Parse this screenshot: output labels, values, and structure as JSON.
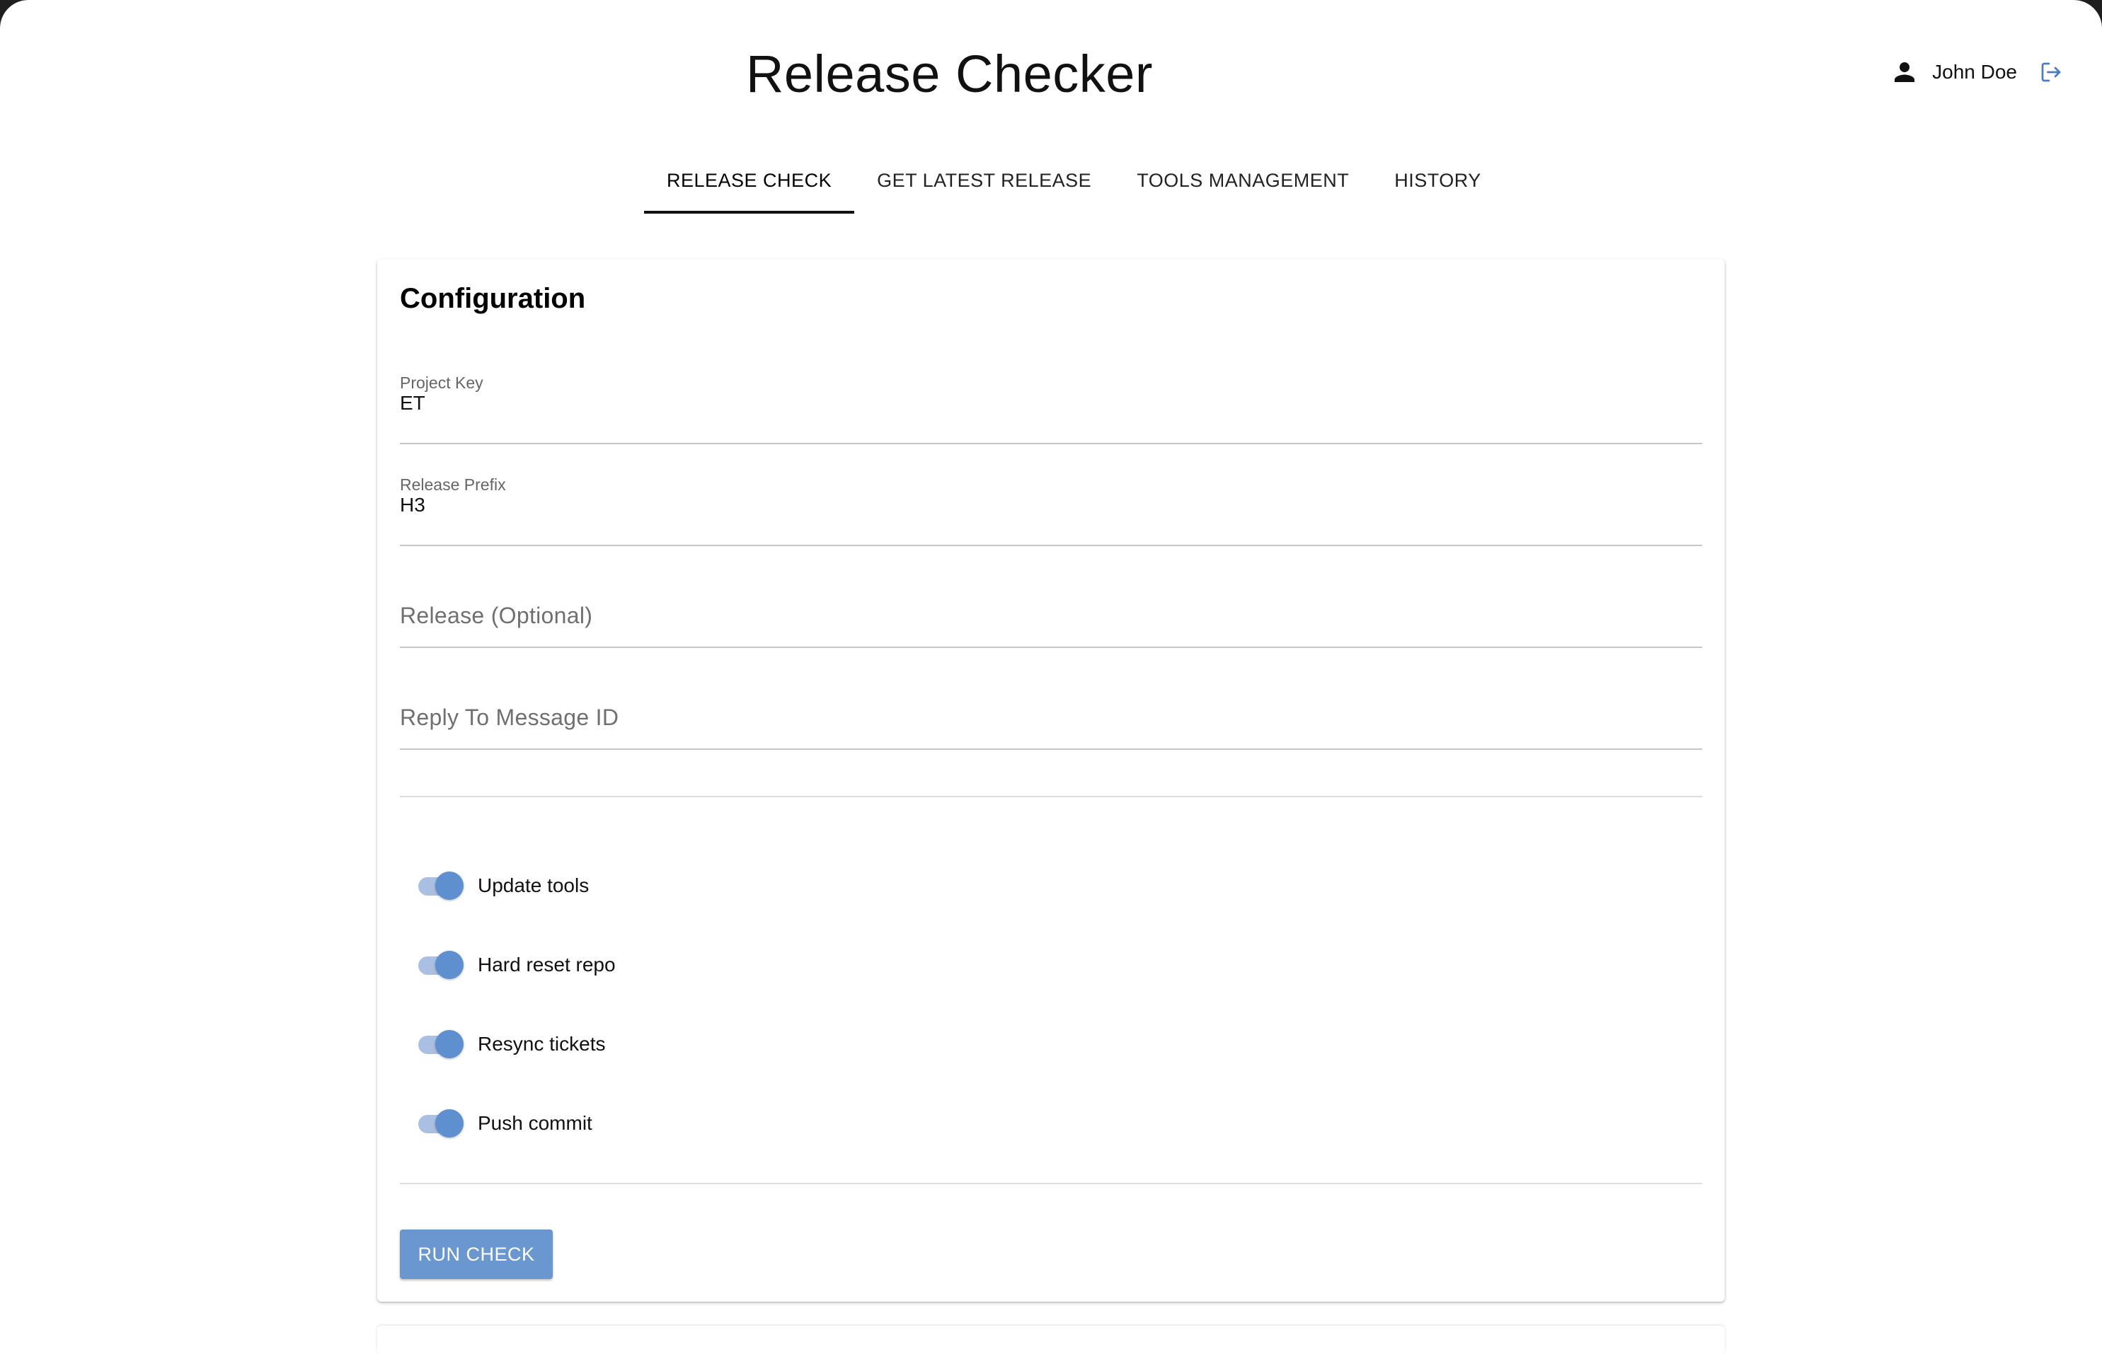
{
  "app": {
    "title": "Release Checker"
  },
  "user": {
    "name": "John Doe",
    "avatar_icon": "person-icon",
    "logout_icon": "logout-icon",
    "logout_icon_color": "#4a7bc4"
  },
  "tabs": [
    {
      "label": "RELEASE CHECK",
      "active": true
    },
    {
      "label": "GET LATEST RELEASE",
      "active": false
    },
    {
      "label": "TOOLS MANAGEMENT",
      "active": false
    },
    {
      "label": "HISTORY",
      "active": false
    }
  ],
  "configuration": {
    "title": "Configuration",
    "fields": {
      "project_key": {
        "label": "Project Key",
        "value": "ET"
      },
      "release_prefix": {
        "label": "Release Prefix",
        "value": "H3"
      },
      "release": {
        "placeholder": "Release (Optional)",
        "value": ""
      },
      "reply_to_message_id": {
        "placeholder": "Reply To Message ID",
        "value": ""
      }
    },
    "toggles": [
      {
        "label": "Update tools",
        "checked": true
      },
      {
        "label": "Hard reset repo",
        "checked": true
      },
      {
        "label": "Resync tickets",
        "checked": true
      },
      {
        "label": "Push commit",
        "checked": true
      }
    ],
    "run_button_label": "RUN CHECK"
  },
  "colors": {
    "accent": "#6a97d0",
    "switch_thumb": "#5e8fcf",
    "switch_track": "#a9c0e3"
  }
}
